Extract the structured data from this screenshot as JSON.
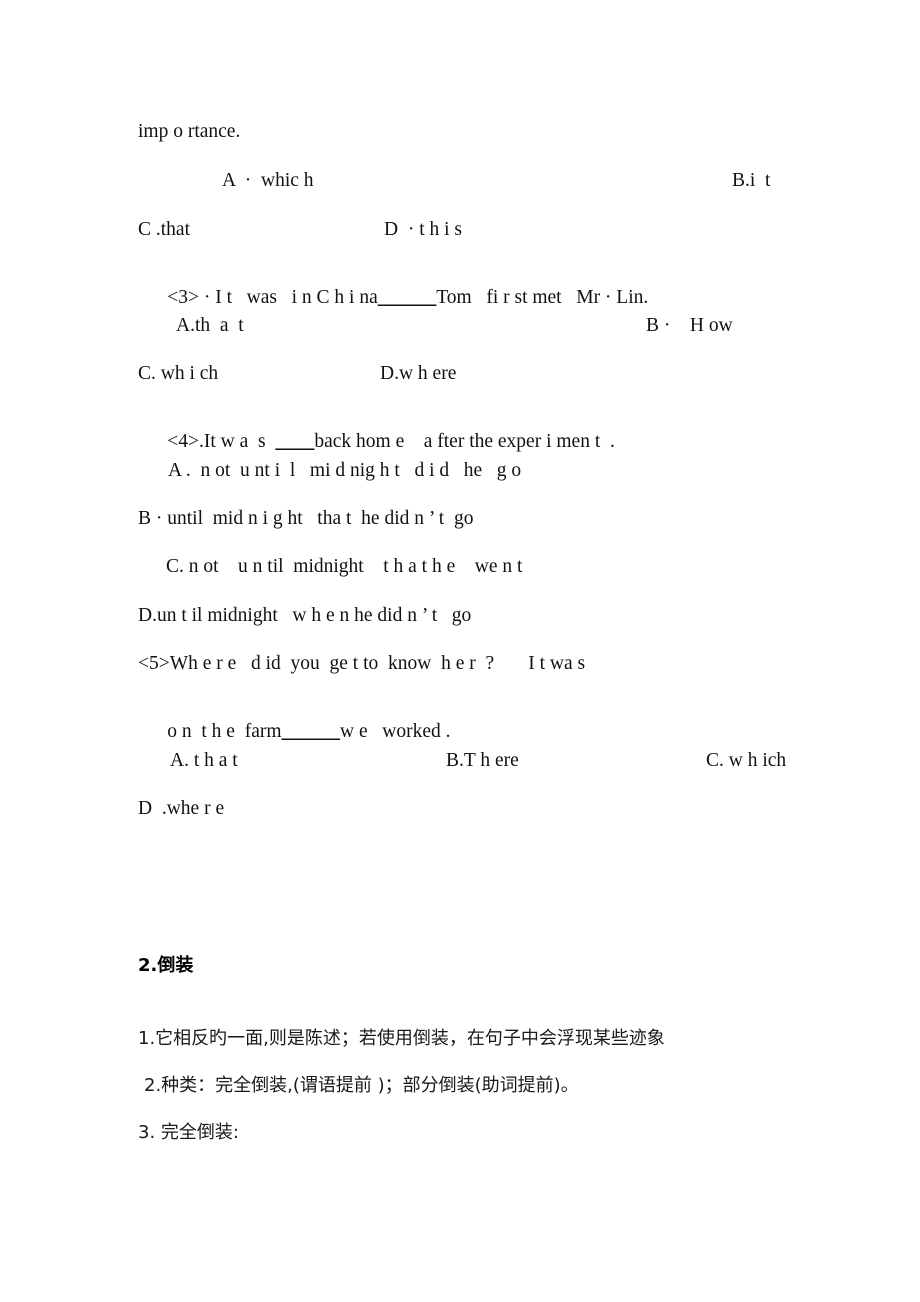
{
  "document": {
    "type": "english-grammar-worksheet",
    "background_color": "#ffffff",
    "text_color": "#111111"
  },
  "english_section": {
    "continuation_line": "imp o rtance.",
    "q2_options": {
      "a": "A  ·  whic h",
      "b": "B.i  t",
      "c": "C .that",
      "d": "D  · t h i s"
    },
    "q3": {
      "stem_before_blank": "<3> · I t   was   i n C h i na",
      "stem_blank": "______",
      "stem_after_blank": "Tom   fi r st met   Mr · Lin.",
      "options": {
        "a": "A.th  a  t",
        "b": "B ·    H ow",
        "c": "C. wh i ch",
        "d": "D.w h ere"
      }
    },
    "q4": {
      "stem_before_blank": "<4>.It w a  s  ",
      "stem_blank": "____",
      "stem_after_blank": "back hom e    a fter the exper i men t  .",
      "options": {
        "a": "A .  n ot  u nt i  l   mi d nig h t   d i d   he   g o",
        "b": "B · until  mid n i g ht   tha t  he did n ’ t  go",
        "c": "C. n ot    u n til  midnight    t h a t h e    we n t",
        "d": "D.un t il midnight   w h e n he did n ’ t   go"
      }
    },
    "q5": {
      "stem_line1": "<5>Wh e r e   d id  you  ge t to  know  h e r  ?       I t wa s",
      "stem_line2_before_blank": "o n  t h e  farm",
      "stem_line2_blank": "______",
      "stem_line2_after_blank": "w e   worked .",
      "options": {
        "a": "A. t h a t",
        "b": "B.T h ere",
        "c": "C. w h ich",
        "d": "D  .whe r e"
      }
    }
  },
  "chinese_section": {
    "heading": "2.倒装",
    "lines": [
      "1.它相反旳一面,则是陈述；若使用倒装，在句子中会浮现某些迹象",
      "2.种类：完全倒装,(谓语提前 )；部分倒装(助词提前)。",
      "3. 完全倒装:"
    ]
  }
}
